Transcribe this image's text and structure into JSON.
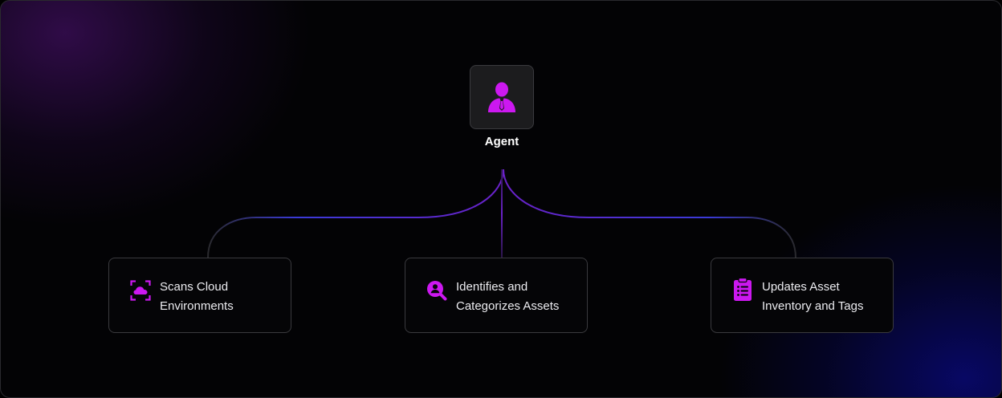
{
  "agent": {
    "label": "Agent",
    "icon": "user-tie-icon"
  },
  "tasks": [
    {
      "line1": "Scans Cloud",
      "line2": "Environments",
      "icon": "cloud-scan-icon"
    },
    {
      "line1": "Identifies and",
      "line2": "Categorizes Assets",
      "icon": "user-search-icon"
    },
    {
      "line1": "Updates Asset",
      "line2": "Inventory and Tags",
      "icon": "clipboard-list-icon"
    }
  ],
  "colors": {
    "icon_accent": "#cc18f0",
    "connector_purple": "#5b1fb3",
    "connector_blue": "#2a35d6"
  }
}
